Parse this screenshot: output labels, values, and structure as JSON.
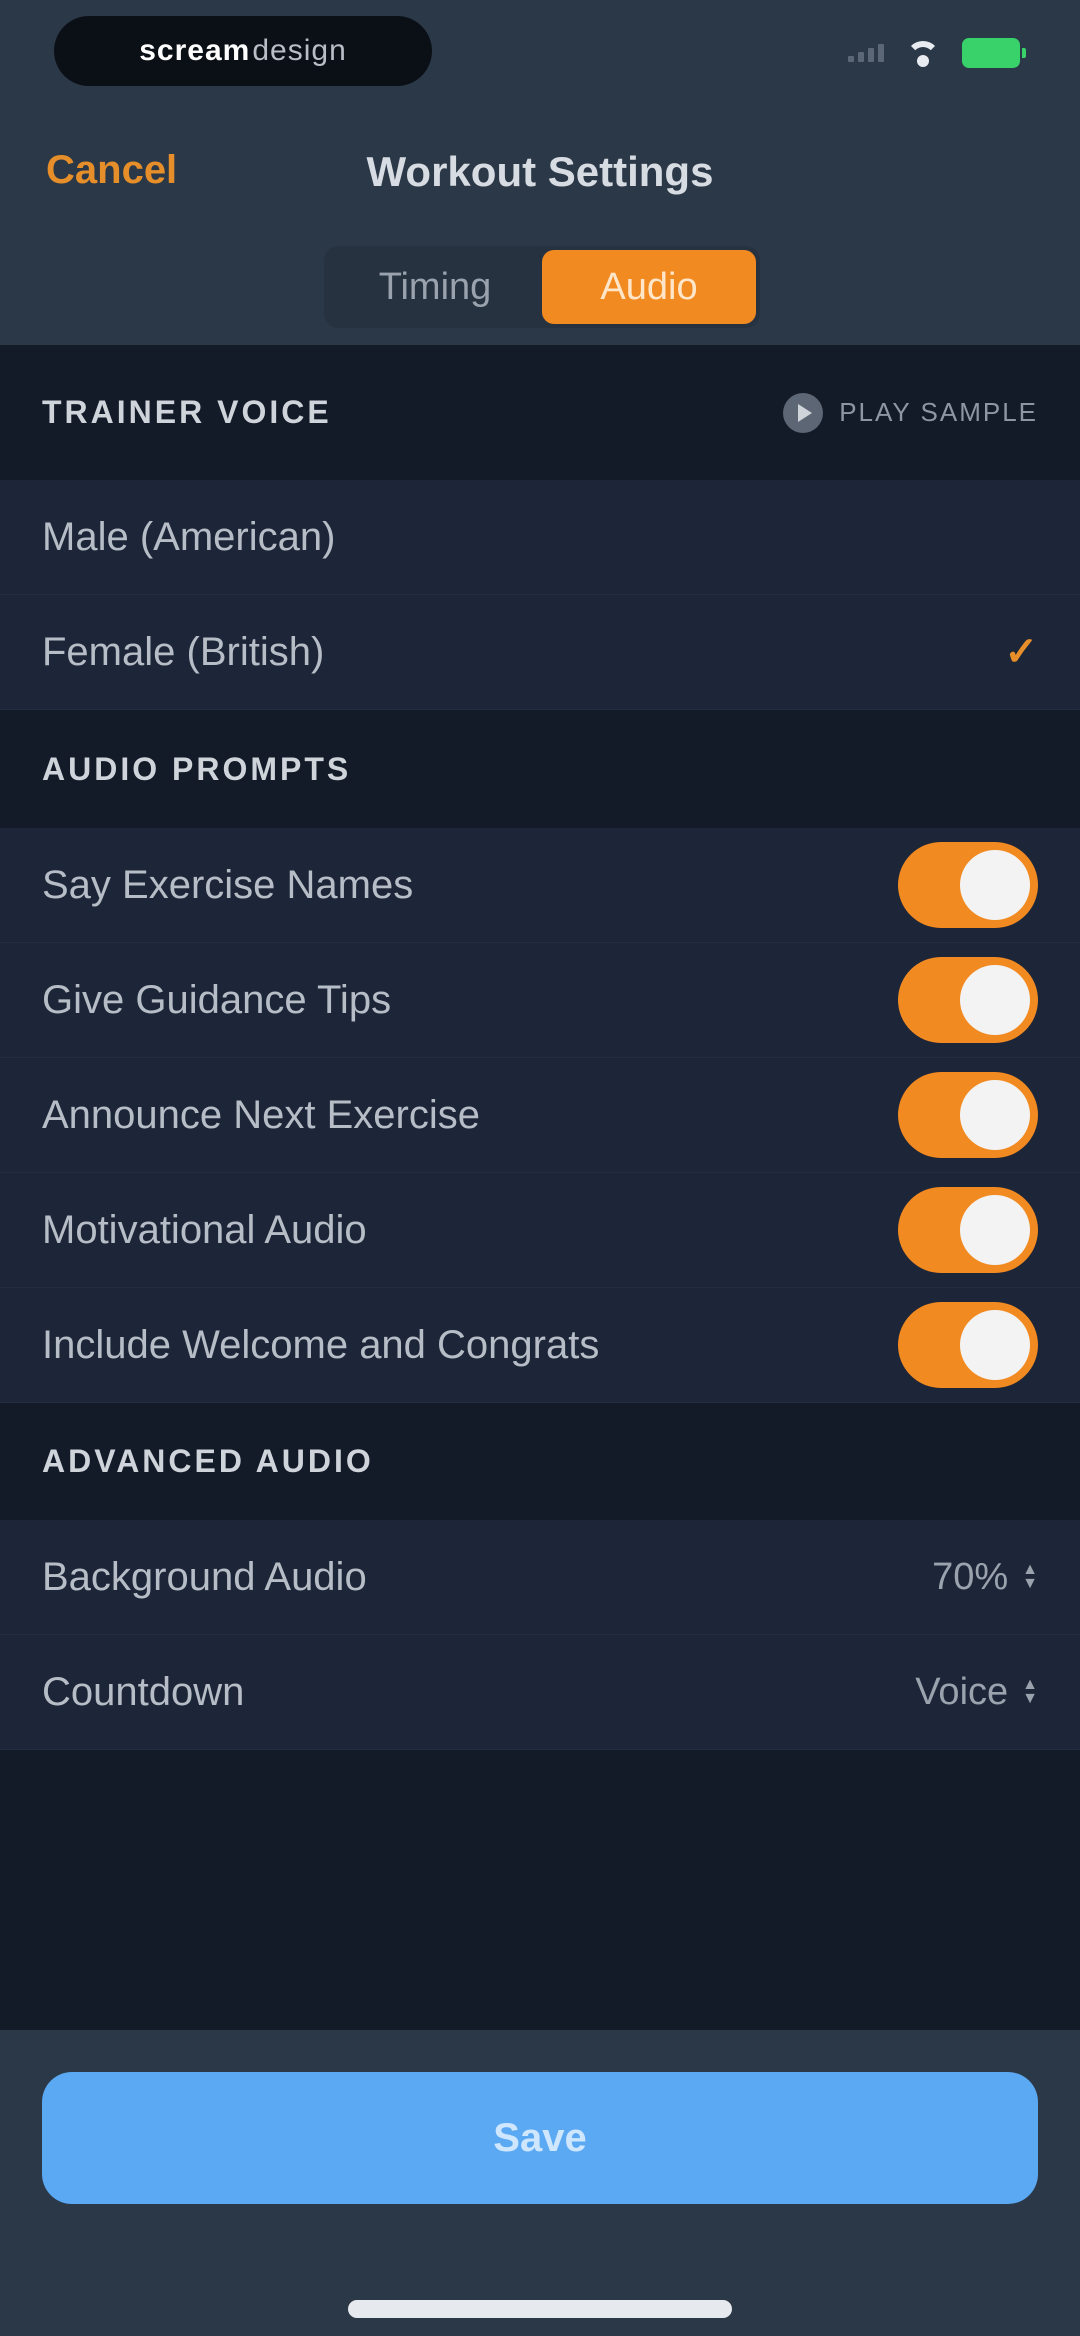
{
  "status_bar": {
    "pill_bold": "scream",
    "pill_light": "design",
    "wifi_icon": "wifi-icon",
    "battery_icon": "battery-icon",
    "battery_color": "#38d16a"
  },
  "header": {
    "cancel_label": "Cancel",
    "title": "Workout Settings",
    "tabs": [
      {
        "label": "Timing",
        "active": false
      },
      {
        "label": "Audio",
        "active": true
      }
    ]
  },
  "trainer_voice": {
    "header": "TRAINER VOICE",
    "play_sample_label": "PLAY SAMPLE",
    "options": [
      {
        "label": "Male (American)",
        "selected": false
      },
      {
        "label": "Female (British)",
        "selected": true
      }
    ],
    "check_glyph": "✓"
  },
  "audio_prompts": {
    "header": "AUDIO PROMPTS",
    "items": [
      {
        "label": "Say Exercise Names",
        "on": true
      },
      {
        "label": "Give Guidance Tips",
        "on": true
      },
      {
        "label": "Announce Next Exercise",
        "on": true
      },
      {
        "label": "Motivational Audio",
        "on": true
      },
      {
        "label": "Include Welcome and Congrats",
        "on": true
      }
    ]
  },
  "advanced_audio": {
    "header": "ADVANCED AUDIO",
    "items": [
      {
        "label": "Background Audio",
        "value": "70%"
      },
      {
        "label": "Countdown",
        "value": "Voice"
      }
    ]
  },
  "footer": {
    "save_label": "Save"
  },
  "colors": {
    "accent": "#f28a22",
    "save_button": "#5aa9f2",
    "header_bg": "#2b3848",
    "row_bg": "#1d2638",
    "section_bg": "#131a28"
  }
}
